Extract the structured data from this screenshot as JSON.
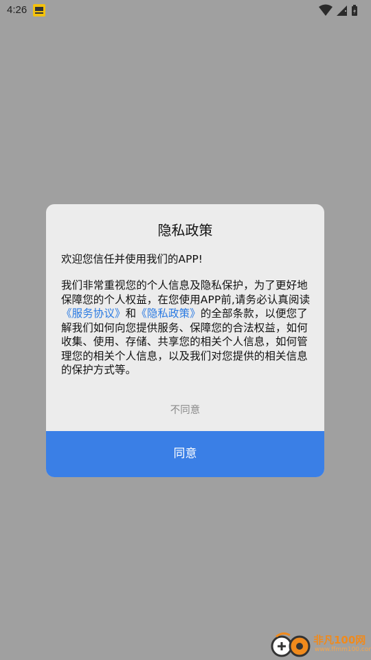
{
  "status_bar": {
    "time": "4:26",
    "app_icon": "notification-app-icon",
    "icons": [
      "wifi-icon",
      "signal-icon",
      "battery-icon"
    ]
  },
  "dialog": {
    "title": "隐私政策",
    "greeting": "欢迎您信任并使用我们的APP!",
    "body_part1": " 我们非常重视您的个人信息及隐私保护，为了更好地保障您的个人权益，在您使用APP前,请务必认真阅读",
    "service_agreement_link": "《服务协议》",
    "and_text": "和",
    "privacy_policy_link": "《隐私政策》",
    "body_part2": "的全部条款，以便您了解我们如何向您提供服务、保障您的合法权益，如何收集、使用、存储、共享您的相关个人信息，如何管理您的相关个人信息，以及我们对您提供的相关信息的保护方式等。",
    "disagree_label": "不同意",
    "agree_label": "同意"
  },
  "watermark": {
    "name": "非凡100网",
    "url": "www.ffmm100.com"
  },
  "colors": {
    "overlay": "#a0a0a0",
    "dialog_bg": "#ececec",
    "accent": "#3a7fe6",
    "link": "#2a7ae2"
  }
}
